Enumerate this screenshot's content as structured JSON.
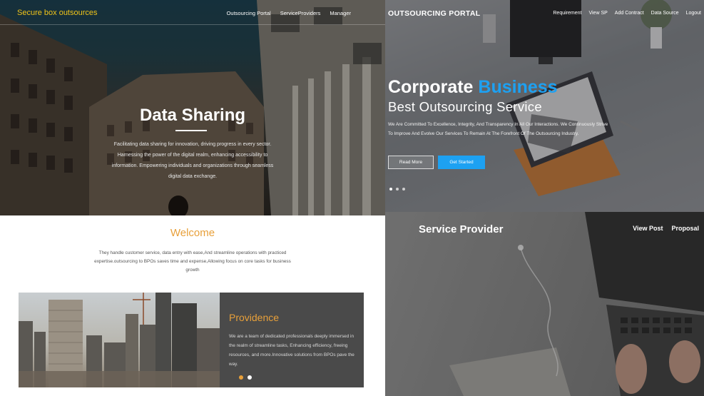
{
  "panel1": {
    "brand": "Secure box outsources",
    "nav": [
      "Outsourcing Portal",
      "ServiceProviders",
      "Manager"
    ],
    "title": "Data Sharing",
    "description": "Facilitating data sharing for innovation, driving progress in every sector. Harnessing the power of the digital realm, enhancing accessibility to information. Empowering individuals and organizations through seamless digital data exchange."
  },
  "panel2": {
    "brand": "OUTSOURCING PORTAL",
    "nav": [
      "Requirement",
      "View SP",
      "Add Contract",
      "Data Source",
      "Logout"
    ],
    "heading_main": "Corporate",
    "heading_accent": "Business",
    "subheading": "Best Outsourcing Service",
    "body": "We Are Committed To Excellence, Integrity, And Transparency In All Our Interactions. We Continuously Strive To Improve And Evolve Our Services To Remain At The Forefront Of The Outsourcing Industry.",
    "read_more": "Read More",
    "get_started": "Get Started",
    "accent_color": "#1da1f2"
  },
  "panel3": {
    "welcome": "Welcome",
    "welcome_desc": "They handle customer service, data entry with ease,And streamline operations with practiced expertise.outsourcing to BPOs saves time and expense,Allowing focus on core tasks for business growth",
    "card_title": "Providence",
    "card_desc": "We are a team of dedicated professionals deeply immersed in the realm of streamline tasks, Enhancing efficiency, freeing resources, and more.Innovative solutions from BPOs pave the way.",
    "accent_color": "#e8a03a"
  },
  "panel4": {
    "title": "Service Provider",
    "nav": [
      "View Post",
      "Proposal"
    ]
  }
}
